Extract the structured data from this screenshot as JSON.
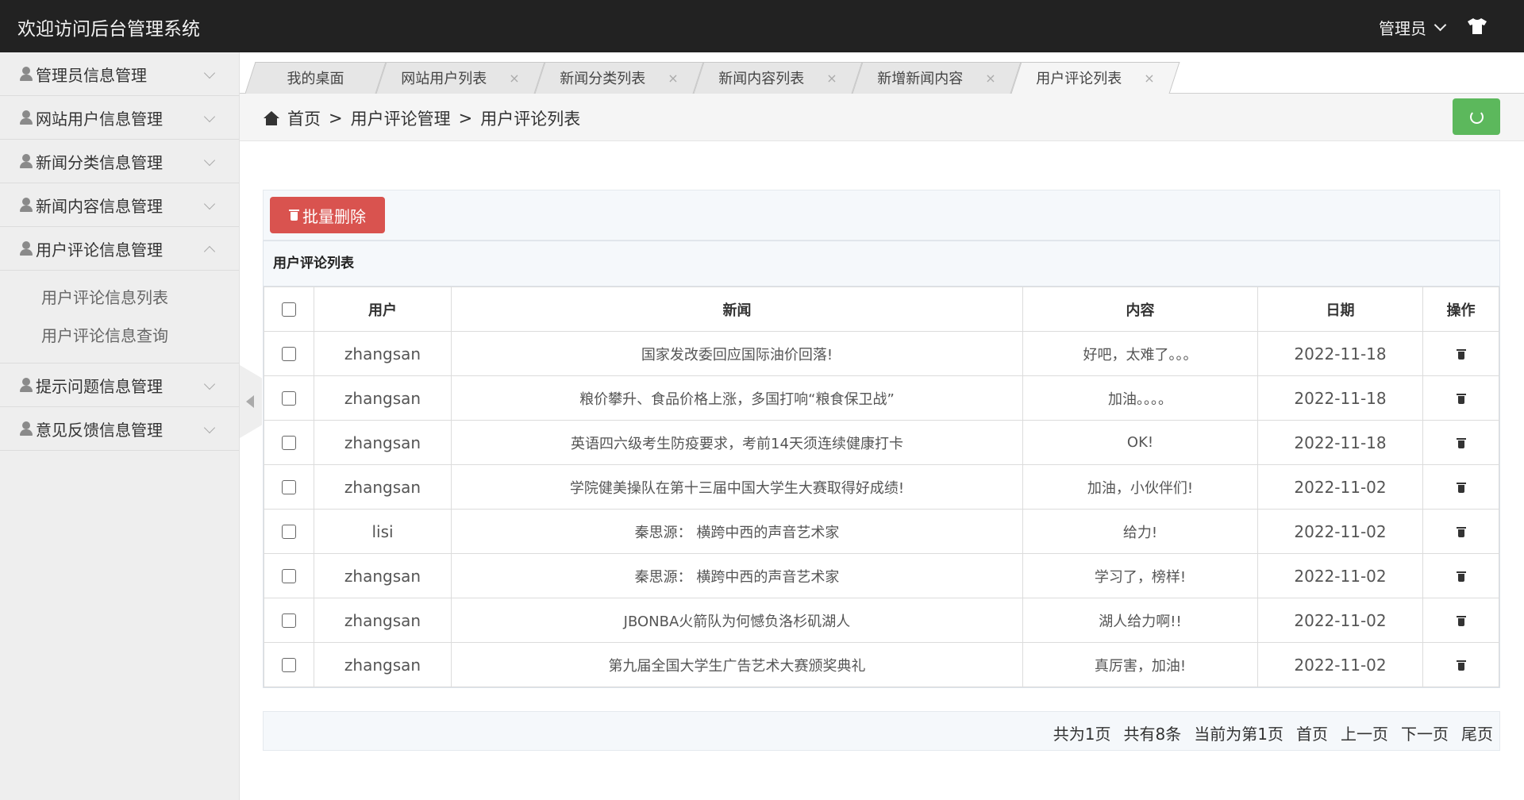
{
  "header": {
    "title": "欢迎访问后台管理系统",
    "admin_label": "管理员",
    "shirt_icon": "tshirt-icon"
  },
  "sidebar": {
    "items": [
      {
        "label": "管理员信息管理",
        "expanded": false
      },
      {
        "label": "网站用户信息管理",
        "expanded": false
      },
      {
        "label": "新闻分类信息管理",
        "expanded": false
      },
      {
        "label": "新闻内容信息管理",
        "expanded": false
      },
      {
        "label": "用户评论信息管理",
        "expanded": true
      },
      {
        "label": "提示问题信息管理",
        "expanded": false
      },
      {
        "label": "意见反馈信息管理",
        "expanded": false
      }
    ],
    "subitems": [
      "用户评论信息列表",
      "用户评论信息查询"
    ]
  },
  "tabs": [
    {
      "label": "我的桌面",
      "closable": false
    },
    {
      "label": "网站用户列表",
      "closable": true
    },
    {
      "label": "新闻分类列表",
      "closable": true
    },
    {
      "label": "新闻内容列表",
      "closable": true
    },
    {
      "label": "新增新闻内容",
      "closable": true
    },
    {
      "label": "用户评论列表",
      "closable": true,
      "active": true
    }
  ],
  "close_glyph": "×",
  "breadcrumb": {
    "home": "首页",
    "sep": ">",
    "level1": "用户评论管理",
    "level2": "用户评论列表"
  },
  "toolbar": {
    "batch_delete_label": "批量删除"
  },
  "panel": {
    "title": "用户评论列表",
    "columns": [
      "用户",
      "新闻",
      "内容",
      "日期",
      "操作"
    ],
    "rows": [
      {
        "user": "zhangsan",
        "news": "国家发改委回应国际油价回落!",
        "content": "好吧，太难了。。。",
        "date": "2022-11-18"
      },
      {
        "user": "zhangsan",
        "news": "粮价攀升、食品价格上涨，多国打响“粮食保卫战”",
        "content": "加油。。。。",
        "date": "2022-11-18"
      },
      {
        "user": "zhangsan",
        "news": "英语四六级考生防疫要求，考前14天须连续健康打卡",
        "content": "OK!",
        "date": "2022-11-18"
      },
      {
        "user": "zhangsan",
        "news": "学院健美操队在第十三届中国大学生大赛取得好成绩!",
        "content": "加油，小伙伴们!",
        "date": "2022-11-02"
      },
      {
        "user": "lisi",
        "news": "秦思源： 横跨中西的声音艺术家",
        "content": "给力!",
        "date": "2022-11-02"
      },
      {
        "user": "zhangsan",
        "news": "秦思源： 横跨中西的声音艺术家",
        "content": "学习了，榜样!",
        "date": "2022-11-02"
      },
      {
        "user": "zhangsan",
        "news": "JBONBA火箭队为何憾负洛杉矶湖人",
        "content": "湖人给力啊!!",
        "date": "2022-11-02"
      },
      {
        "user": "zhangsan",
        "news": "第九届全国大学生广告艺术大赛颁奖典礼",
        "content": "真厉害，加油!",
        "date": "2022-11-02"
      }
    ]
  },
  "pager": {
    "total_pages": "共为1页",
    "total_items": "共有8条",
    "current": "当前为第1页",
    "first": "首页",
    "prev": "上一页",
    "next": "下一页",
    "last": "尾页"
  },
  "colors": {
    "header_bg": "#222222",
    "danger": "#d9534f",
    "success": "#5cb85c"
  }
}
